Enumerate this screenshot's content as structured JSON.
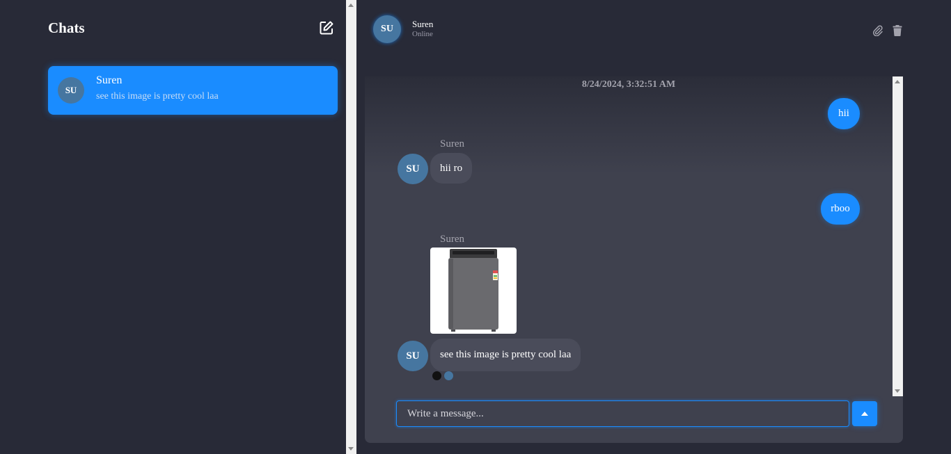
{
  "sidebar": {
    "title": "Chats",
    "new_chat_icon": "edit-icon",
    "chats": [
      {
        "initials": "SU",
        "name": "Suren",
        "preview": "see this image is pretty cool laa",
        "active": true
      }
    ]
  },
  "header": {
    "initials": "SU",
    "name": "Suren",
    "status": "Online",
    "icons": [
      "paperclip-icon",
      "trash-icon"
    ]
  },
  "conversation": {
    "timestamp": "8/24/2024, 3:32:51 AM",
    "messages": [
      {
        "direction": "out",
        "text": "hii"
      },
      {
        "direction": "in",
        "sender": "Suren",
        "initials": "SU",
        "text": "hii ro"
      },
      {
        "direction": "out",
        "text": "rboo"
      },
      {
        "direction": "in",
        "sender": "Suren",
        "type": "image",
        "image_subject": "washing machine"
      },
      {
        "direction": "in",
        "initials": "SU",
        "text": "see this image is pretty cool laa"
      }
    ]
  },
  "composer": {
    "placeholder": "Write a message...",
    "send_icon": "caret-up-icon"
  },
  "colors": {
    "accent": "#1a8cff",
    "avatar": "#4676a0",
    "background": "#282a37",
    "panel": "#3f414e",
    "incoming_bubble": "#4a4c5a"
  }
}
